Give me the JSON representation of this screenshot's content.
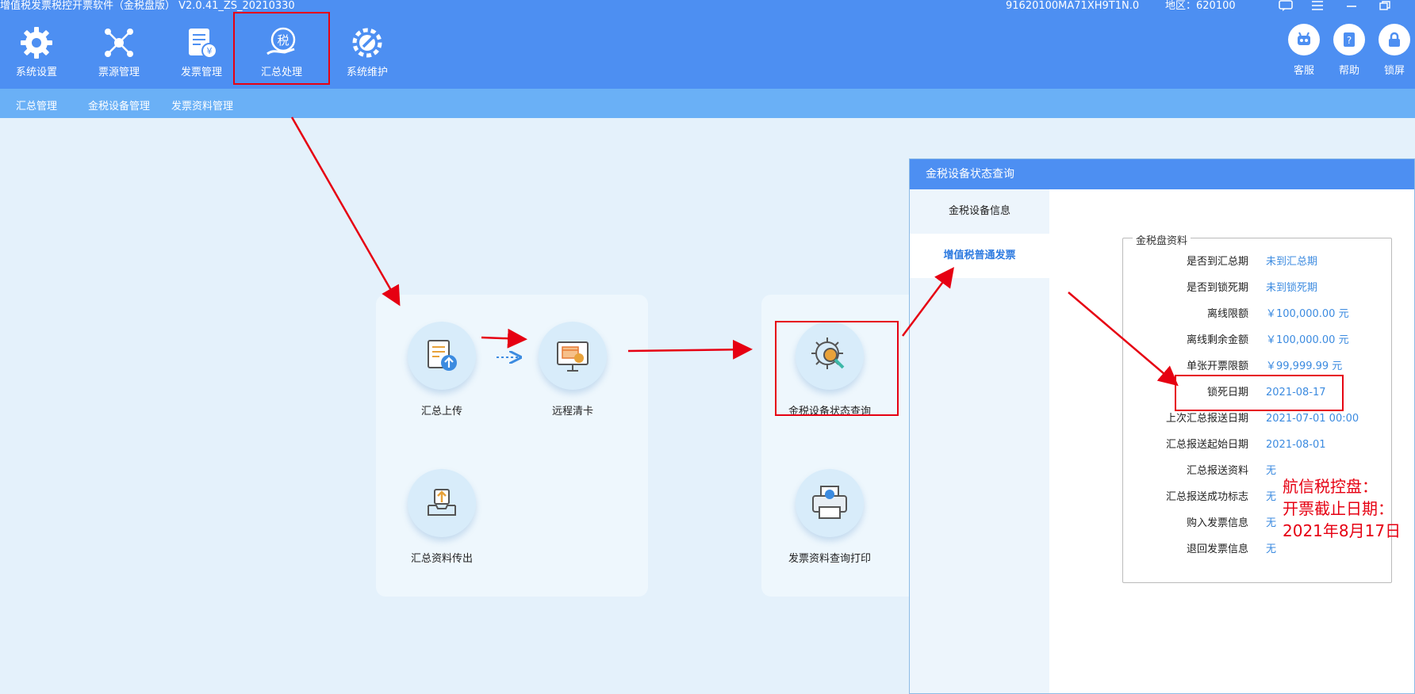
{
  "header": {
    "title": "增值税发票税控开票软件（金税盘版） V2.0.41_ZS_20210330",
    "tax_id": "91620100MA71XH9T1N.0",
    "region": "地区：620100"
  },
  "nav": [
    {
      "label": "系统设置",
      "icon": "gear-icon"
    },
    {
      "label": "票源管理",
      "icon": "network-icon"
    },
    {
      "label": "发票管理",
      "icon": "invoice-icon"
    },
    {
      "label": "汇总处理",
      "icon": "tax-hand-icon"
    },
    {
      "label": "系统维护",
      "icon": "wrench-gear-icon"
    }
  ],
  "right_buttons": [
    {
      "label": "客服",
      "icon": "robot-icon"
    },
    {
      "label": "帮助",
      "icon": "help-book-icon"
    },
    {
      "label": "锁屏",
      "icon": "lock-icon"
    }
  ],
  "subnav": [
    "汇总管理",
    "金税设备管理",
    "发票资料管理"
  ],
  "functions": {
    "upload": "汇总上传",
    "remote_clear": "远程清卡",
    "export": "汇总资料传出",
    "status_query": "金税设备状态查询",
    "print": "发票资料查询打印"
  },
  "panel": {
    "title": "金税设备状态查询",
    "side_items": [
      "金税设备信息",
      "增值税普通发票"
    ],
    "group_title": "金税盘资料",
    "rows": [
      {
        "key": "是否到汇总期",
        "value": "未到汇总期"
      },
      {
        "key": "是否到锁死期",
        "value": "未到锁死期"
      },
      {
        "key": "离线限额",
        "value": "￥100,000.00 元"
      },
      {
        "key": "离线剩余金额",
        "value": "￥100,000.00 元"
      },
      {
        "key": "单张开票限额",
        "value": "￥99,999.99 元"
      },
      {
        "key": "锁死日期",
        "value": "2021-08-17"
      },
      {
        "key": "上次汇总报送日期",
        "value": "2021-07-01 00:00"
      },
      {
        "key": "汇总报送起始日期",
        "value": "2021-08-01"
      },
      {
        "key": "汇总报送资料",
        "value": "无"
      },
      {
        "key": "汇总报送成功标志",
        "value": "无"
      },
      {
        "key": "购入发票信息",
        "value": "无"
      },
      {
        "key": "退回发票信息",
        "value": "无"
      }
    ]
  },
  "annotation": {
    "line1": "航信税控盘：",
    "line2": "开票截止日期：",
    "line3": "2021年8月17日"
  },
  "colors": {
    "header": "#4d8ff2",
    "subnav": "#6ab0f6",
    "highlight": "#e60012",
    "value": "#3c8be0"
  }
}
